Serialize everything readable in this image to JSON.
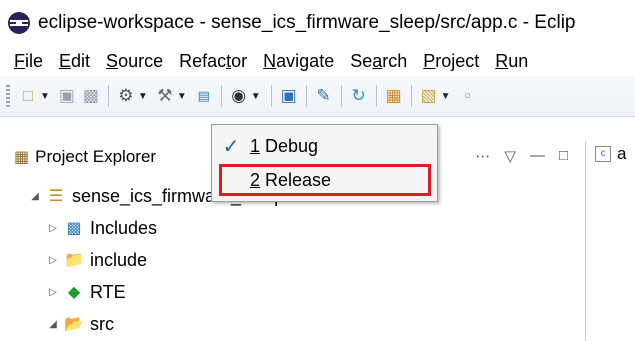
{
  "window": {
    "title": "eclipse-workspace - sense_ics_firmware_sleep/src/app.c - Eclip"
  },
  "menubar": {
    "items": [
      {
        "pre": "",
        "mnem": "F",
        "post": "ile"
      },
      {
        "pre": "",
        "mnem": "E",
        "post": "dit"
      },
      {
        "pre": "",
        "mnem": "S",
        "post": "ource"
      },
      {
        "pre": "Refac",
        "mnem": "t",
        "post": "or"
      },
      {
        "pre": "",
        "mnem": "N",
        "post": "avigate"
      },
      {
        "pre": "Se",
        "mnem": "a",
        "post": "rch"
      },
      {
        "pre": "",
        "mnem": "P",
        "post": "roject"
      },
      {
        "pre": "",
        "mnem": "R",
        "post": "un"
      }
    ]
  },
  "toolbar": {
    "icons": [
      "new-icon",
      "save-icon",
      "save-all-icon",
      "settings-icon",
      "build-hammer-icon",
      "binary-icon",
      "debug-icon",
      "console-icon",
      "pencil-icon",
      "refresh-icon",
      "package-icon",
      "new-class-icon",
      "new-file-icon"
    ]
  },
  "project_explorer": {
    "tab_label": "Project Explorer",
    "project_name": "sense_ics_firmware_sleep",
    "nodes": [
      {
        "label": "Includes",
        "expanded": false,
        "icon": "includes-icon"
      },
      {
        "label": "include",
        "expanded": false,
        "icon": "folder-icon"
      },
      {
        "label": "RTE",
        "expanded": false,
        "icon": "rte-icon"
      },
      {
        "label": "src",
        "expanded": true,
        "icon": "folder-icon"
      }
    ]
  },
  "editor": {
    "tab_label": "a"
  },
  "build_dropdown": {
    "items": [
      {
        "mnem": "1",
        "label": " Debug",
        "checked": true
      },
      {
        "mnem": "2",
        "label": " Release",
        "checked": false,
        "highlighted": true
      }
    ]
  },
  "colors": {
    "highlight": "#e31b23",
    "check": "#1a5fb4"
  }
}
